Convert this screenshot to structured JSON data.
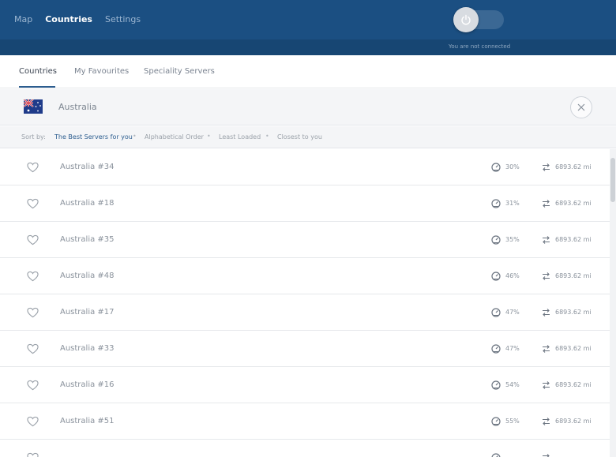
{
  "nav": {
    "items": [
      {
        "label": "Map",
        "active": false
      },
      {
        "label": "Countries",
        "active": true
      },
      {
        "label": "Settings",
        "active": false
      }
    ]
  },
  "connection": {
    "status": "You are not connected",
    "icon": "power-icon",
    "connected": false
  },
  "tabs": [
    {
      "label": "Countries",
      "active": true
    },
    {
      "label": "My Favourites",
      "active": false
    },
    {
      "label": "Speciality Servers",
      "active": false
    }
  ],
  "search": {
    "value": "Australia",
    "flag": "australia-flag",
    "clear_icon": "close-icon"
  },
  "sort": {
    "label": "Sort by:",
    "options": [
      {
        "label": "The Best Servers for you",
        "active": true
      },
      {
        "label": "Alphabetical Order",
        "active": false
      },
      {
        "label": "Least Loaded",
        "active": false
      },
      {
        "label": "Closest to you",
        "active": false
      }
    ]
  },
  "servers": [
    {
      "name": "Australia #34",
      "load": "30%",
      "distance": "6893.62 mi"
    },
    {
      "name": "Australia #18",
      "load": "31%",
      "distance": "6893.62 mi"
    },
    {
      "name": "Australia #35",
      "load": "35%",
      "distance": "6893.62 mi"
    },
    {
      "name": "Australia #48",
      "load": "46%",
      "distance": "6893.62 mi"
    },
    {
      "name": "Australia #17",
      "load": "47%",
      "distance": "6893.62 mi"
    },
    {
      "name": "Australia #33",
      "load": "47%",
      "distance": "6893.62 mi"
    },
    {
      "name": "Australia #16",
      "load": "54%",
      "distance": "6893.62 mi"
    },
    {
      "name": "Australia #51",
      "load": "55%",
      "distance": "6893.62 mi"
    },
    {
      "name": "",
      "load": "",
      "distance": ""
    }
  ],
  "colors": {
    "header": "#1b4f82",
    "accent": "#2c5d8f",
    "background": "#ffffff",
    "panel": "#f4f5f7"
  }
}
